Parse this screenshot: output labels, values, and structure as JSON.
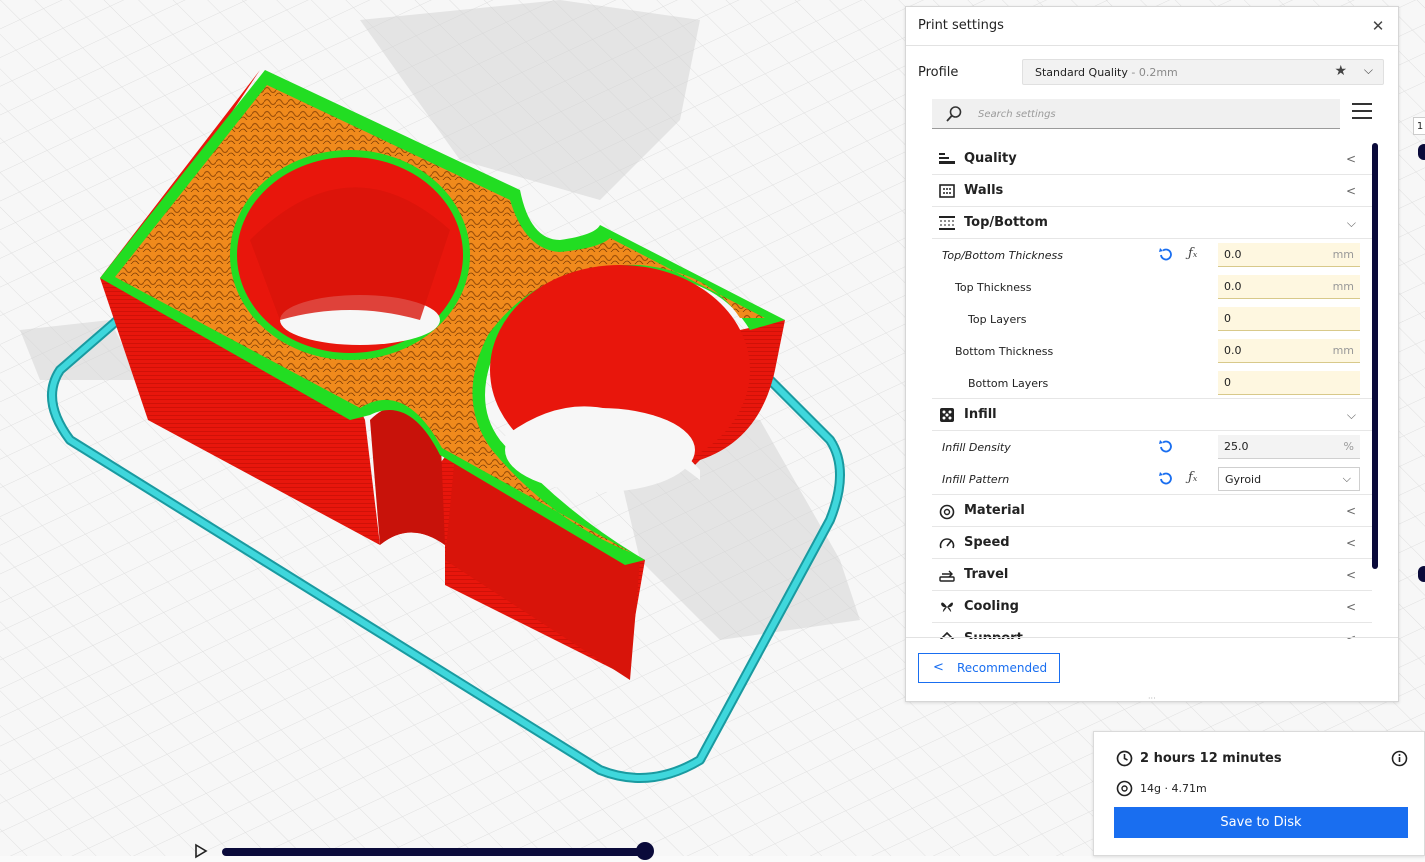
{
  "panel": {
    "title": "Print settings",
    "profile_label": "Profile",
    "profile_name": "Standard Quality",
    "profile_sub": " - 0.2mm",
    "search_placeholder": "Search settings"
  },
  "categories": {
    "quality": "Quality",
    "walls": "Walls",
    "topbottom": "Top/Bottom",
    "infill": "Infill",
    "material": "Material",
    "speed": "Speed",
    "travel": "Travel",
    "cooling": "Cooling",
    "support": "Support"
  },
  "topbottom": {
    "thickness_label": "Top/Bottom Thickness",
    "thickness_value": "0.0",
    "top_thickness_label": "Top Thickness",
    "top_thickness_value": "0.0",
    "top_layers_label": "Top Layers",
    "top_layers_value": "0",
    "bottom_thickness_label": "Bottom Thickness",
    "bottom_thickness_value": "0.0",
    "bottom_layers_label": "Bottom Layers",
    "bottom_layers_value": "0",
    "unit": "mm"
  },
  "infill": {
    "density_label": "Infill Density",
    "density_value": "25.0",
    "density_unit": "%",
    "pattern_label": "Infill Pattern",
    "pattern_value": "Gyroid"
  },
  "buttons": {
    "recommended": "Recommended",
    "save": "Save to Disk"
  },
  "summary": {
    "time": "2 hours 12 minutes",
    "material": "14g · 4.71m"
  },
  "viewport": {
    "layer_number": "1"
  },
  "colors": {
    "accent": "#196ef0",
    "model_wall": "#e8160c",
    "model_skin": "#22dd22",
    "model_infill": "#f08a1c",
    "skirt": "#3fd7dc",
    "slider": "#0a0a3a"
  }
}
